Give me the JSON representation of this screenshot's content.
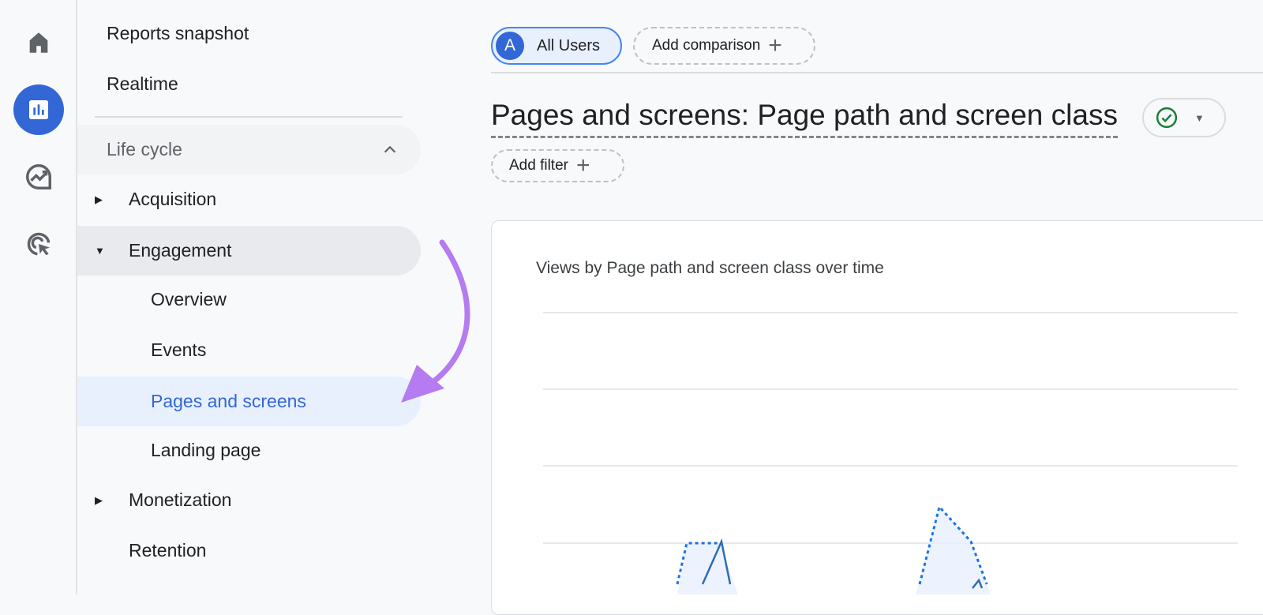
{
  "rail": {
    "icons": [
      "home-icon",
      "reports-icon",
      "explore-icon",
      "advertising-icon"
    ],
    "active_color": "#3367d6"
  },
  "nav": {
    "reports_snapshot": "Reports snapshot",
    "realtime": "Realtime",
    "life_cycle": "Life cycle",
    "acquisition": "Acquisition",
    "engagement": "Engagement",
    "overview": "Overview",
    "events": "Events",
    "pages_and_screens": "Pages and screens",
    "landing_page": "Landing page",
    "monetization": "Monetization",
    "retention": "Retention"
  },
  "header": {
    "segment_avatar": "A",
    "segment_label": "All Users",
    "add_comparison": "Add comparison",
    "title": "Pages and screens: Page path and screen class",
    "add_filter": "Add filter"
  },
  "chart": {
    "title": "Views by Page path and screen class over time",
    "series_color": "#1a73e8"
  },
  "annotation": {
    "arrow_color": "#b57bf0"
  }
}
